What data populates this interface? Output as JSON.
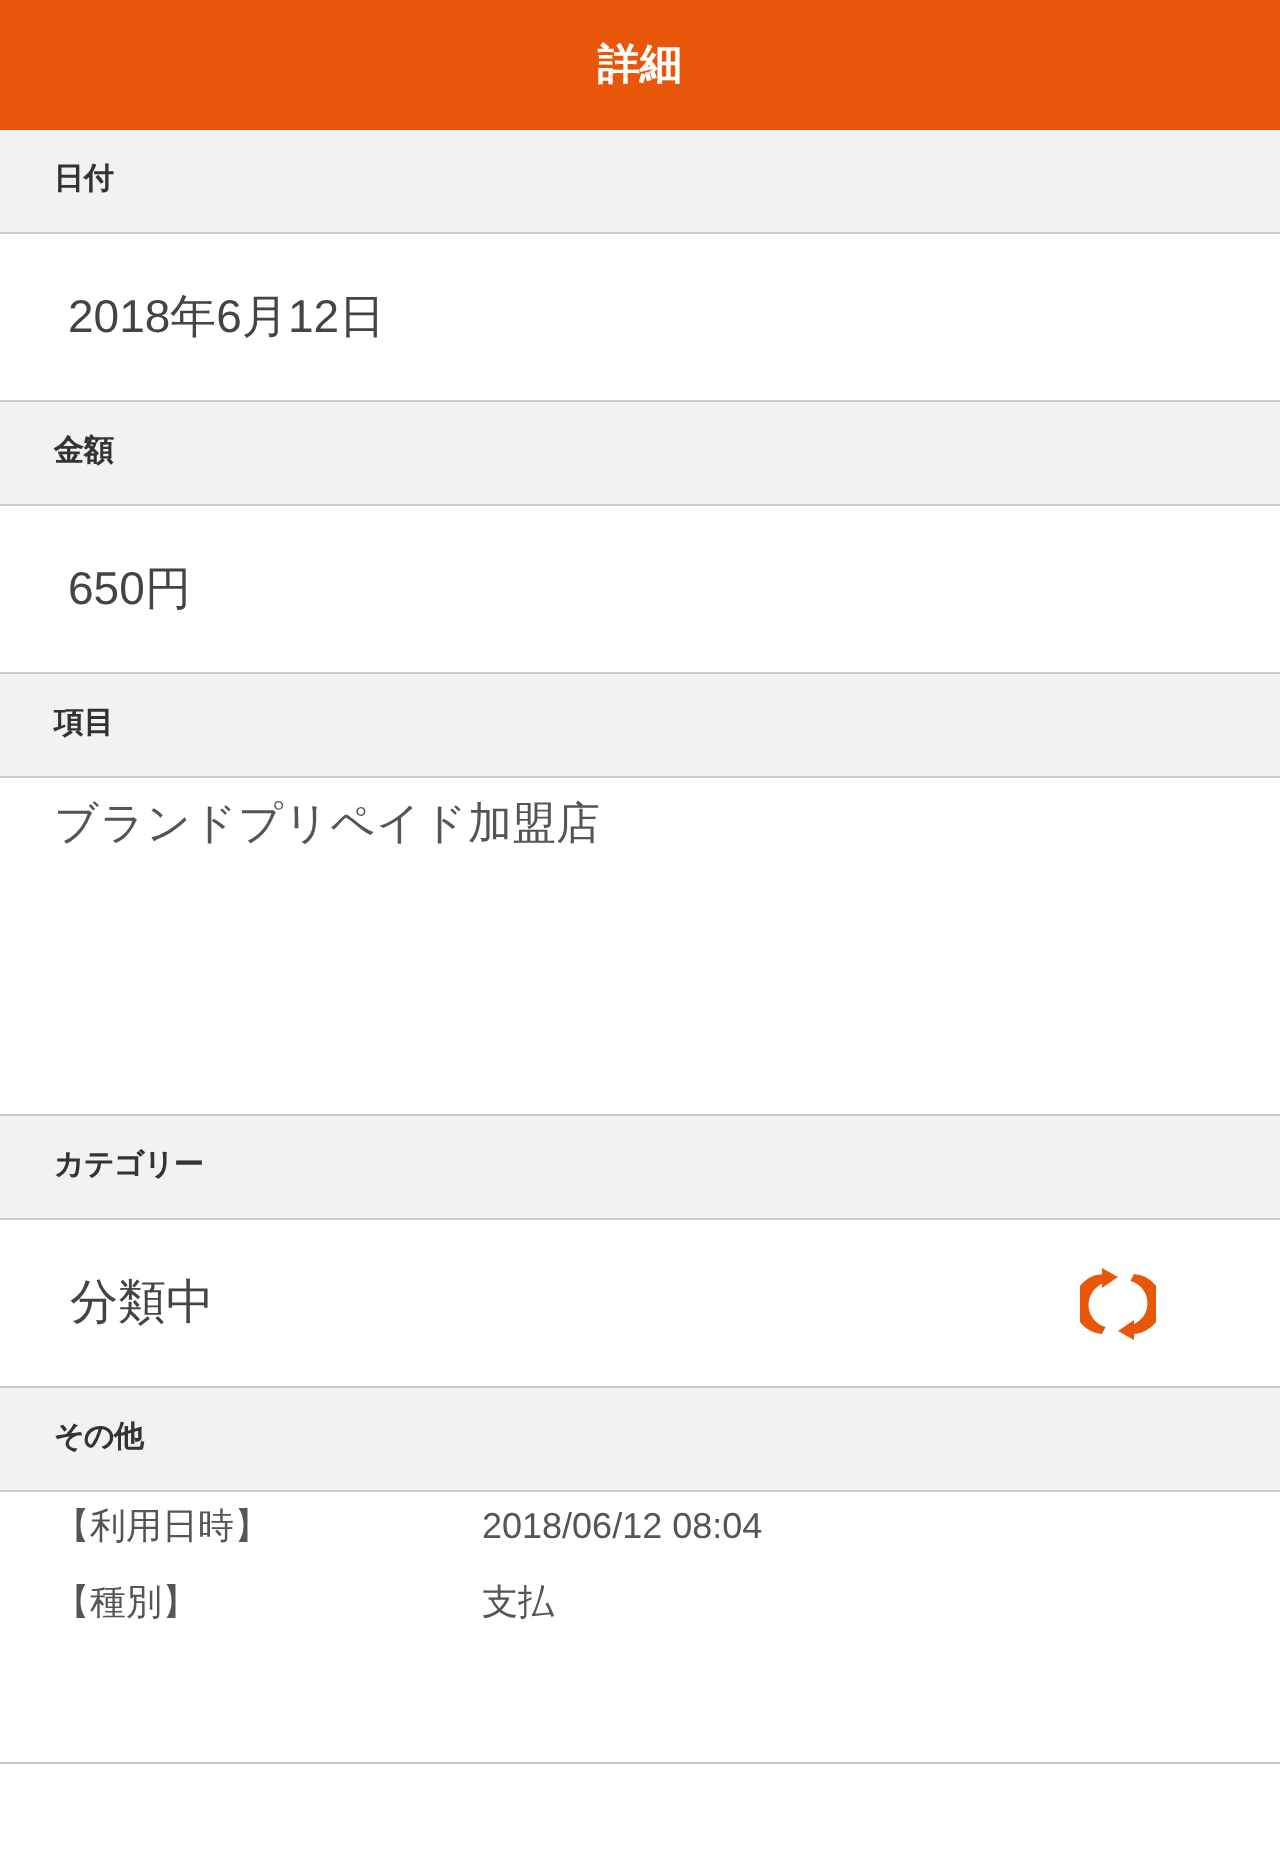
{
  "header": {
    "title": "詳細"
  },
  "sections": [
    {
      "kind": "value",
      "label": "日付",
      "value": "2018年6月12日"
    },
    {
      "kind": "value",
      "label": "金額",
      "value": "650円"
    },
    {
      "kind": "text",
      "label": "項目",
      "value": "ブランドプリペイド加盟店"
    },
    {
      "kind": "category",
      "label": "カテゴリー",
      "value": "分類中"
    },
    {
      "kind": "details",
      "label": "その他",
      "rows": [
        {
          "label": "【利用日時】",
          "value": "2018/06/12 08:04"
        },
        {
          "label": "【種別】",
          "value": "支払"
        }
      ]
    }
  ]
}
